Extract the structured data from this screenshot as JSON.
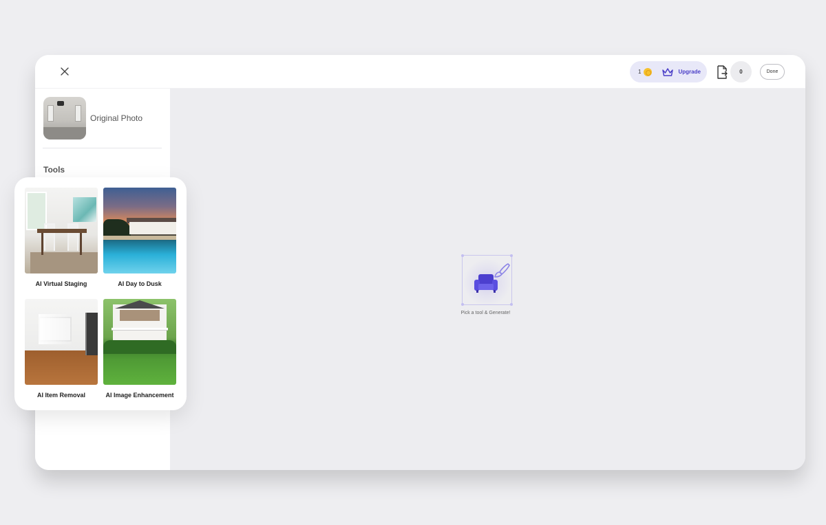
{
  "topbar": {
    "credits": "1",
    "upgrade_label": "Upgrade",
    "export_count": "0",
    "done_label": "Done"
  },
  "sidebar": {
    "original_photo_label": "Original Photo",
    "tools_heading": "Tools"
  },
  "tools": [
    {
      "label": "AI Virtual Staging"
    },
    {
      "label": "AI Day to Dusk"
    },
    {
      "label": "AI Item Removal"
    },
    {
      "label": "AI Image Enhancement"
    }
  ],
  "canvas": {
    "empty_caption": "Pick a tool & Generate!"
  },
  "colors": {
    "accent": "#4a3ec7",
    "credits_pill": "#e8e8f8",
    "coin": "#f6c12e"
  },
  "icons": {
    "close": "close-icon",
    "coin": "coin-icon",
    "crown": "crown-icon",
    "export": "export-icon",
    "armchair": "armchair-icon",
    "brush": "brush-icon"
  }
}
